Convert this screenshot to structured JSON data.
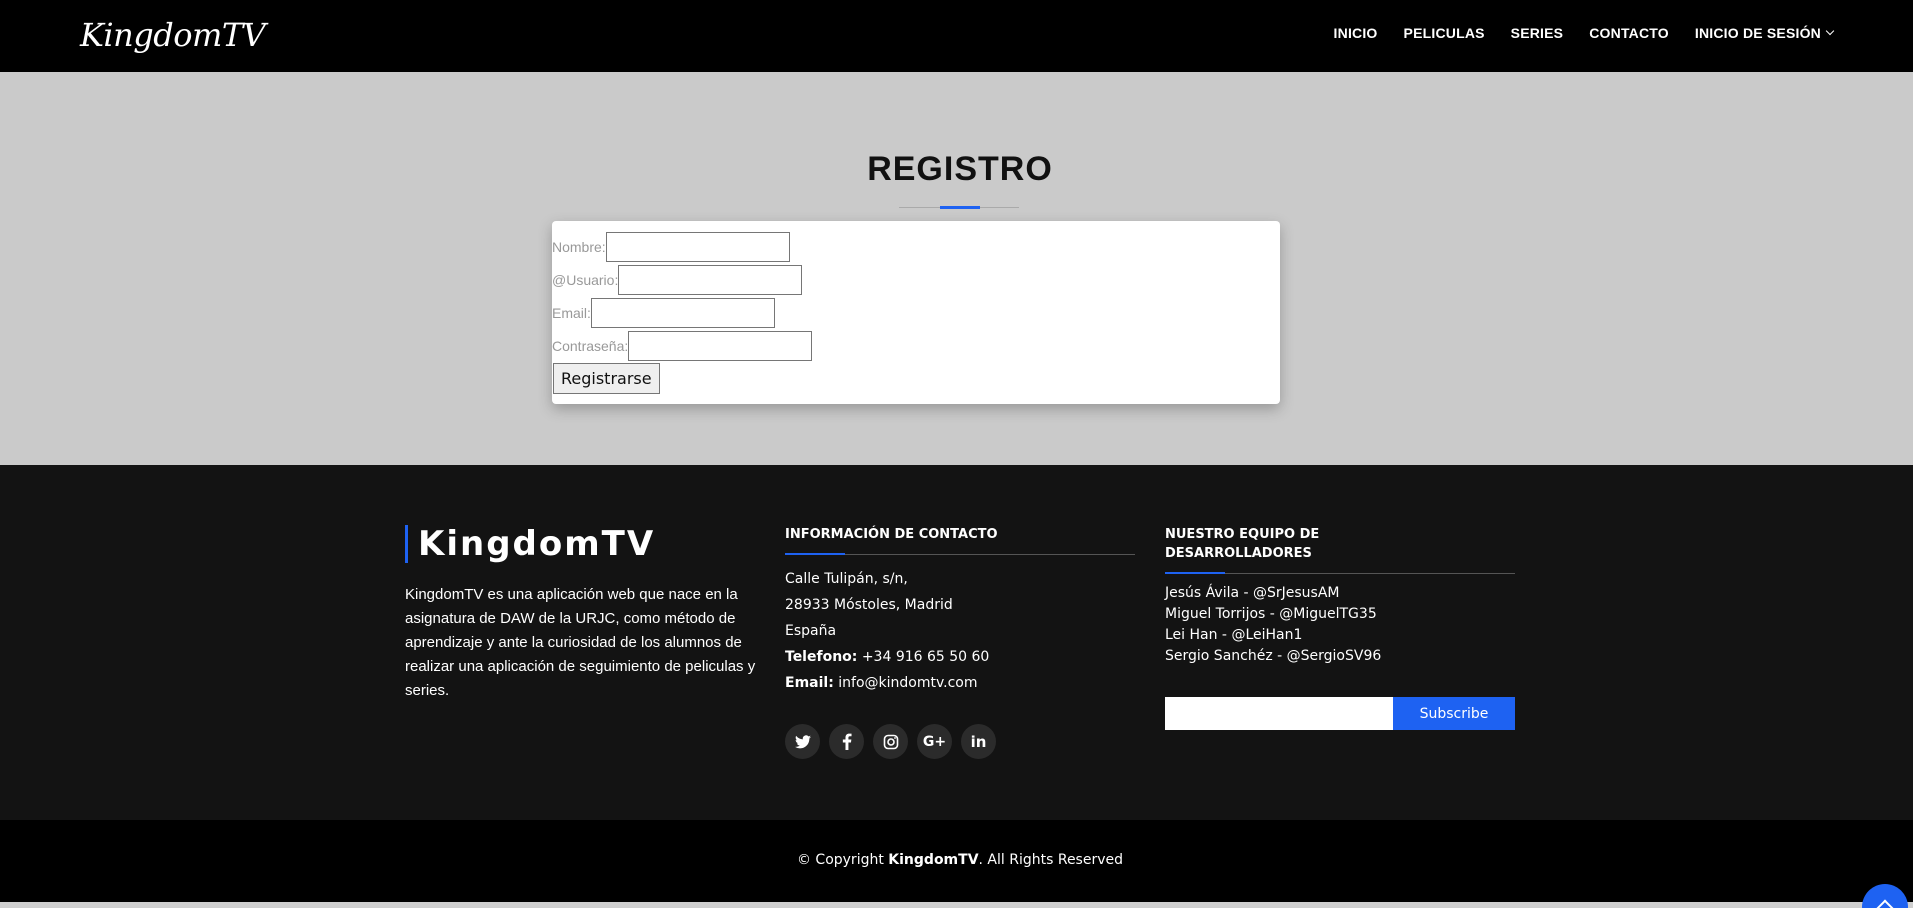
{
  "header": {
    "logo": "KingdomTV",
    "nav": [
      "INICIO",
      "PELICULAS",
      "SERIES",
      "CONTACTO",
      "INICIO DE SESIÓN"
    ]
  },
  "registro": {
    "title": "REGISTRO",
    "fields": [
      {
        "label": "Nombre:",
        "value": ""
      },
      {
        "label": "@Usuario:",
        "value": ""
      },
      {
        "label": "Email:",
        "value": ""
      },
      {
        "label": "Contraseña:",
        "value": ""
      }
    ],
    "submit_label": "Registrarse"
  },
  "footer": {
    "brand": "KingdomTV",
    "about": "KingdomTV es una aplicación web que nace en la asignatura de DAW de la URJC, como método de aprendizaje y ante la curiosidad de los alumnos de realizar una aplicación de seguimiento de peliculas y series.",
    "contact": {
      "title": "INFORMACIÓN DE CONTACTO",
      "address_1": "Calle Tulipán, s/n,",
      "address_2": "28933 Móstoles, Madrid",
      "country": "España",
      "phone_label": "Telefono:",
      "phone": "+34 916 65 50 60",
      "email_label": "Email:",
      "email": "info@kindomtv.com"
    },
    "socials": [
      "twitter-icon",
      "facebook-icon",
      "instagram-icon",
      "google-plus-icon",
      "linkedin-icon"
    ],
    "team": {
      "title_1": "NUESTRO EQUIPO DE",
      "title_2": "DESARROLLADORES",
      "members": [
        "Jesús Ávila - @SrJesusAM",
        "Miguel Torrijos - @MiguelTG35",
        "Lei Han - @LeiHan1",
        "Sergio Sanchéz - @SergioSV96"
      ]
    },
    "subscribe": {
      "placeholder": "",
      "button": "Subscribe"
    },
    "copyright_prefix": "© Copyright",
    "copyright_brand": "KingdomTV",
    "copyright_suffix": ". All Rights Reserved"
  },
  "colors": {
    "accent": "#1e62f2",
    "header_bg": "#000000",
    "footer_bg": "#131313",
    "page_bg": "#cacaca"
  }
}
